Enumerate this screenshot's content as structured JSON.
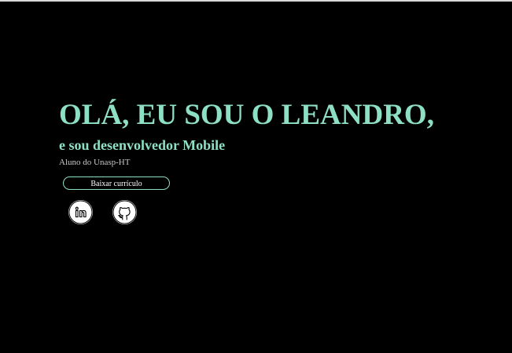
{
  "hero": {
    "title": "OLÁ, EU SOU O LEANDRO,",
    "subtitle": "e sou desenvolvedor Mobile",
    "tagline": "Aluno do Unasp-HT"
  },
  "actions": {
    "cv_button_label": "Baixar currículo"
  },
  "social": [
    {
      "icon": "linkedin-icon"
    },
    {
      "icon": "github-icon"
    }
  ],
  "colors": {
    "background": "#000000",
    "accent": "#8ee0c4",
    "muted_text": "#c8c8c8",
    "button_text": "#ffffff",
    "icon_bg": "#ffffff"
  }
}
